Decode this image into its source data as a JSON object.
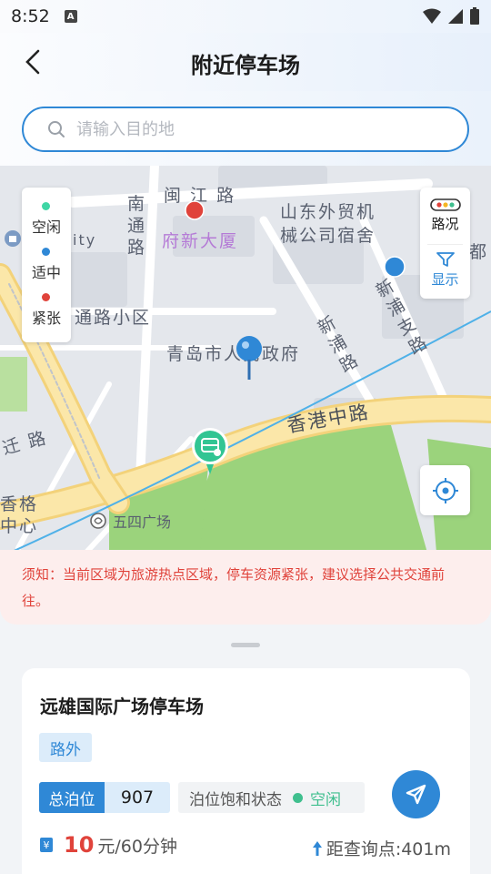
{
  "status_bar": {
    "time": "8:52",
    "notif_letter": "A"
  },
  "header": {
    "title": "附近停车场"
  },
  "search": {
    "placeholder": "请输入目的地",
    "value": ""
  },
  "map": {
    "labels": {
      "minjiang": "闽 江 路",
      "nantong": "南\n通\n路",
      "fuxin": "府新大厦",
      "shandong": "山东外贸机",
      "shandong2": "械公司宿舍",
      "city": "ity",
      "tonglu": "通路小区",
      "gov": "青岛市人民政府",
      "hongkong": "香港中路",
      "xinpu": "新\n浦\n路",
      "xinpuzhi": "新\n浦\n支\n路",
      "wusi": "五四广场",
      "qianlu": "迁 路",
      "xiangge": "香格\n中心",
      "du": "都"
    },
    "legend": [
      {
        "label": "空闲",
        "color": "#3fd6a5"
      },
      {
        "label": "适中",
        "color": "#2f88d6"
      },
      {
        "label": "紧张",
        "color": "#e0433b"
      }
    ],
    "tools": {
      "traffic": "路况",
      "display": "显示"
    }
  },
  "notice": {
    "text": "须知：当前区域为旅游热点区域，停车资源紧张，建议选择公共交通前往。"
  },
  "parking": {
    "name": "远雄国际广场停车场",
    "tag": "路外",
    "total_label": "总泊位",
    "total_value": "907",
    "status_label": "泊位饱和状态",
    "status_value": "空闲",
    "status_color": "#3fbf8e",
    "price_num": "10",
    "price_unit": "元/60分钟",
    "distance": "距查询点:401m"
  }
}
